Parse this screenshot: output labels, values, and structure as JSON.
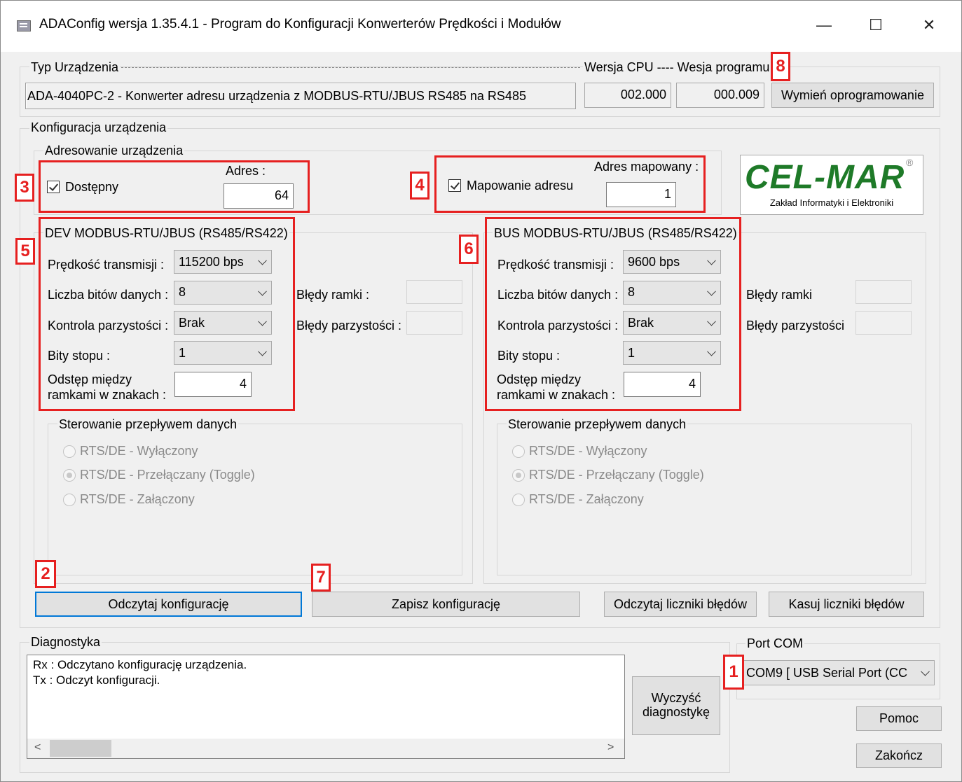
{
  "window": {
    "title": "ADAConfig  wersja 1.35.4.1 - Program do Konfiguracji Konwerterów Prędkości i Modułów",
    "app_icon": "app-icon",
    "controls": {
      "minimize": "—",
      "maximize": "☐",
      "close": "✕"
    }
  },
  "device_type": {
    "label": "Typ Urządzenia",
    "value": "ADA-4040PC-2 - Konwerter adresu urządzenia z MODBUS-RTU/JBUS RS485 na RS485",
    "cpu_version_label": "Wersja CPU ---- Wesja programu",
    "cpu_version": "002.000",
    "program_version": "000.009",
    "firmware_button": "Wymień oprogramowanie"
  },
  "config": {
    "label": "Konfiguracja urządzenia",
    "addressing_label": "Adresowanie urządzenia",
    "available_label": "Dostępny",
    "available_checked": true,
    "address_label": "Adres :",
    "address_value": "64",
    "mapping_label": "Mapowanie adresu",
    "mapping_checked": true,
    "mapped_address_label": "Adres mapowany :",
    "mapped_address_value": "1"
  },
  "logo": {
    "main": "CEL-MAR",
    "registered": "®",
    "sub": "Zakład Informatyki i Elektroniki"
  },
  "dev": {
    "title": "DEV MODBUS-RTU/JBUS (RS485/RS422)",
    "baud_label": "Prędkość transmisji :",
    "baud_value": "115200 bps",
    "bits_label": "Liczba bitów danych :",
    "bits_value": "8",
    "parity_label": "Kontrola parzystości :",
    "parity_value": "Brak",
    "stop_label": "Bity stopu :",
    "stop_value": "1",
    "gap_label_1": "Odstęp między",
    "gap_label_2": "ramkami w znakach  :",
    "gap_value": "4",
    "frame_err_label": "Błędy ramki :",
    "parity_err_label": "Błędy parzystości :",
    "flow_label": "Sterowanie przepływem danych",
    "flow_options": [
      "RTS/DE - Wyłączony",
      "RTS/DE - Przełączany (Toggle)",
      "RTS/DE - Załączony"
    ]
  },
  "bus": {
    "title": "BUS MODBUS-RTU/JBUS (RS485/RS422)",
    "baud_label": "Prędkość transmisji :",
    "baud_value": "9600 bps",
    "bits_label": "Liczba bitów danych :",
    "bits_value": "8",
    "parity_label": "Kontrola parzystości :",
    "parity_value": "Brak",
    "stop_label": "Bity stopu :",
    "stop_value": "1",
    "gap_label_1": "Odstęp między",
    "gap_label_2": "ramkami w znakach :",
    "gap_value": "4",
    "frame_err_label": "Błędy ramki",
    "parity_err_label": "Błędy parzystości",
    "flow_label": "Sterowanie przepływem danych",
    "flow_options": [
      "RTS/DE - Wyłączony",
      "RTS/DE - Przełączany (Toggle)",
      "RTS/DE - Załączony"
    ]
  },
  "buttons": {
    "read_config": "Odczytaj konfigurację",
    "save_config": "Zapisz konfigurację",
    "read_counters": "Odczytaj liczniki błędów",
    "clear_counters": "Kasuj liczniki błędów",
    "clear_diag_1": "Wyczyść",
    "clear_diag_2": "diagnostykę",
    "help": "Pomoc",
    "exit": "Zakończ"
  },
  "diagnostics": {
    "label": "Diagnostyka",
    "lines": [
      "Rx : Odczytano konfigurację urządzenia.",
      "Tx : Odczyt konfiguracji."
    ]
  },
  "com": {
    "label": "Port COM",
    "value": "COM9    [ USB Serial Port (CC"
  },
  "markers": [
    "1",
    "2",
    "3",
    "4",
    "5",
    "6",
    "7",
    "8"
  ],
  "colors": {
    "highlight": "#e62020",
    "logo": "#1e7a28",
    "focus": "#0078d7"
  }
}
